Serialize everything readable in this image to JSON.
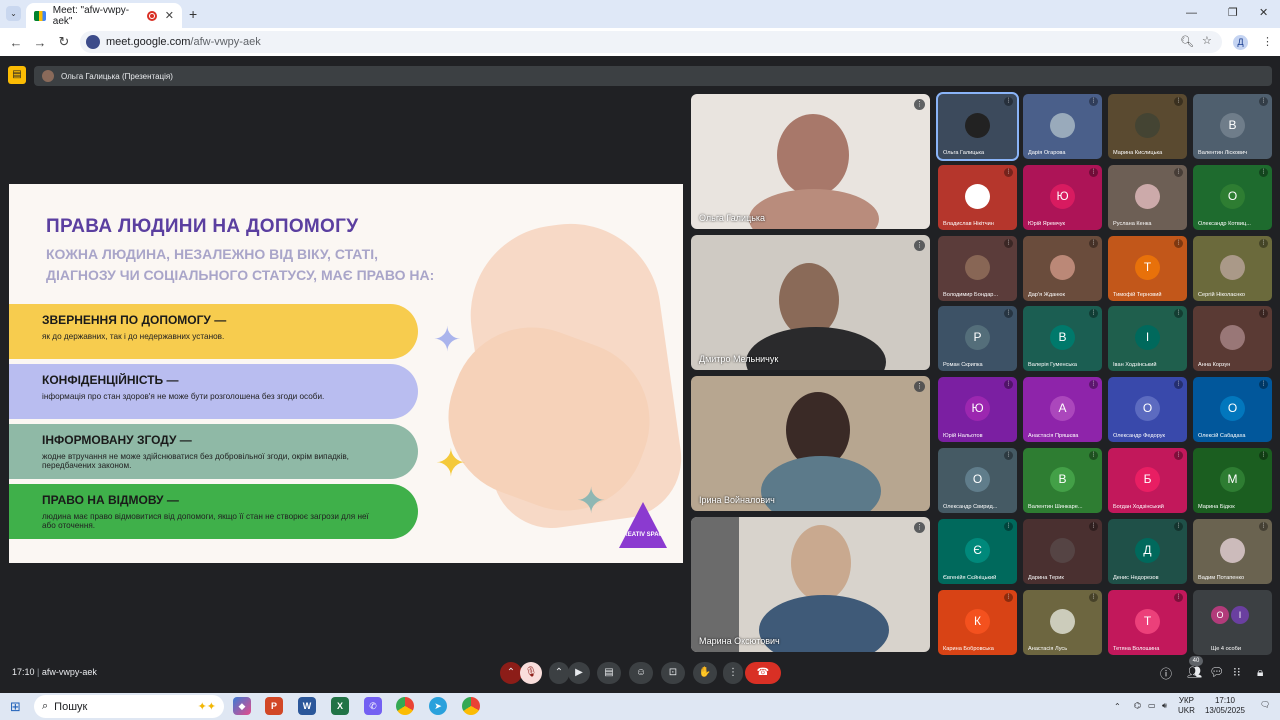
{
  "browser": {
    "tab_title": "Meet: \"afw-vwpy-aek\"",
    "url_host": "meet.google.com",
    "url_path": "/afw-vwpy-aek",
    "profile_initial": "Д"
  },
  "meet": {
    "presenter_label": "Ольга Галицька (Презентація)",
    "time": "17:10",
    "meeting_code": "afw-vwpy-aek",
    "participant_count": "40"
  },
  "slide": {
    "title": "ПРАВА ЛЮДИНИ НА ДОПОМОГУ",
    "subtitle": "КОЖНА ЛЮДИНА, НЕЗАЛЕЖНО ВІД ВІКУ, СТАТІ, ДІАГНОЗУ ЧИ СОЦІАЛЬНОГО СТАТУСУ, МАЄ ПРАВО НА:",
    "items": [
      {
        "heading": "ЗВЕРНЕННЯ ПО ДОПОМОГУ —",
        "text": "як до державних, так і до недержавних установ.",
        "color": "#f7cc4e"
      },
      {
        "heading": "КОНФІДЕНЦІЙНІСТЬ —",
        "text": "інформація про стан здоров'я не може бути розголошена без згоди особи.",
        "color": "#b9bdf0"
      },
      {
        "heading": "ІНФОРМОВАНУ ЗГОДУ —",
        "text": "жодне втручання не може здійснюватися без добровільної згоди, окрім випадків, передбачених законом.",
        "color": "#8fb9a6"
      },
      {
        "heading": "ПРАВО НА ВІДМОВУ —",
        "text": "людина має право відмовитися від допомоги, якщо її стан не створює загрози для неї або оточення.",
        "color": "#3fb04a"
      }
    ],
    "logo_text": "KREATIV SPACE"
  },
  "big_tiles": [
    {
      "name": "Ольга Галицька",
      "bg": "#e9e4df"
    },
    {
      "name": "Дмитро Мельничук",
      "bg": "#cfcac3"
    },
    {
      "name": "Ірина Войналович",
      "bg": "#b7a690"
    },
    {
      "name": "Марина Оксютович",
      "bg": "#d8d3cc"
    }
  ],
  "small_tiles": [
    {
      "name": "Ольга Галицька",
      "initial": "",
      "bg": "#3c4a5c",
      "av": "#222"
    },
    {
      "name": "Дарія Огарова",
      "initial": "",
      "bg": "#4a5f8a",
      "av": "#9ab"
    },
    {
      "name": "Марина Кислицька",
      "initial": "",
      "bg": "#5a4a30",
      "av": "#443"
    },
    {
      "name": "Валентин Ліскович",
      "initial": "В",
      "bg": "#4f5f6e",
      "av": "#6f7d8a"
    },
    {
      "name": "Владислав Нікітчин",
      "initial": "",
      "bg": "#b5362c",
      "av": "#fff"
    },
    {
      "name": "Юрій Яремчук",
      "initial": "Ю",
      "bg": "#ad1457",
      "av": "#d81b60"
    },
    {
      "name": "Руслана Кенка",
      "initial": "",
      "bg": "#6d5f55",
      "av": "#caa"
    },
    {
      "name": "Олександр Котвиц...",
      "initial": "О",
      "bg": "#1e6b2e",
      "av": "#2e7d32"
    },
    {
      "name": "Володимир Бондар...",
      "initial": "",
      "bg": "#5b3c3a",
      "av": "#865"
    },
    {
      "name": "Дар'я Жданюк",
      "initial": "",
      "bg": "#6a4c3c",
      "av": "#b87"
    },
    {
      "name": "Тимофій Терновий",
      "initial": "Т",
      "bg": "#c2571a",
      "av": "#e8710a"
    },
    {
      "name": "Сергій Ніколаєнко",
      "initial": "",
      "bg": "#6b6a3c",
      "av": "#a98"
    },
    {
      "name": "Роман Скрипка",
      "initial": "Р",
      "bg": "#3d5266",
      "av": "#546e7a"
    },
    {
      "name": "Валерія Гуменська",
      "initial": "В",
      "bg": "#1b5e52",
      "av": "#00796b"
    },
    {
      "name": "Іван Ходзінський",
      "initial": "І",
      "bg": "#1f5f4d",
      "av": "#00695c"
    },
    {
      "name": "Анна Корзун",
      "initial": "",
      "bg": "#5a3a34",
      "av": "#977"
    },
    {
      "name": "Юрій Нальотов",
      "initial": "Ю",
      "bg": "#7b1fa2",
      "av": "#9c27b0"
    },
    {
      "name": "Анастасія Пряшєва",
      "initial": "А",
      "bg": "#8e24aa",
      "av": "#ab47bc"
    },
    {
      "name": "Олександр Федорук",
      "initial": "О",
      "bg": "#3949ab",
      "av": "#5c6bc0"
    },
    {
      "name": "Олексій Сабадаха",
      "initial": "О",
      "bg": "#01579b",
      "av": "#0277bd"
    },
    {
      "name": "Олександр Свирид...",
      "initial": "О",
      "bg": "#455a64",
      "av": "#607d8b"
    },
    {
      "name": "Валентин Шинкаре...",
      "initial": "В",
      "bg": "#2e7d32",
      "av": "#43a047"
    },
    {
      "name": "Богдан Ходзінський",
      "initial": "Б",
      "bg": "#c2185b",
      "av": "#e91e63"
    },
    {
      "name": "Марина Бідюк",
      "initial": "М",
      "bg": "#1b5e20",
      "av": "#2e7d32"
    },
    {
      "name": "Євгенійя Сєйніцький",
      "initial": "Є",
      "bg": "#00695c",
      "av": "#00897b"
    },
    {
      "name": "Дарина Терик",
      "initial": "",
      "bg": "#4a3030",
      "av": "#544"
    },
    {
      "name": "Денис Недорезов",
      "initial": "Д",
      "bg": "#1f5048",
      "av": "#00695c"
    },
    {
      "name": "Вадим Потапенко",
      "initial": "",
      "bg": "#6a6350",
      "av": "#cbb"
    },
    {
      "name": "Карина Бобровська",
      "initial": "К",
      "bg": "#d84315",
      "av": "#f4511e"
    },
    {
      "name": "Анастасія Лусь",
      "initial": "",
      "bg": "#6d6640",
      "av": "#ccb"
    },
    {
      "name": "Тетяна Волошина",
      "initial": "Т",
      "bg": "#c2185b",
      "av": "#ec407a"
    },
    {
      "name": "Ще 4 особи",
      "initial": "",
      "bg": "#3c4043",
      "av": "#3c4043"
    }
  ],
  "taskbar": {
    "search_placeholder": "Пошук",
    "lang_top": "УКР",
    "lang_bottom": "UKR",
    "time": "17:10",
    "date": "13/05/2025"
  }
}
